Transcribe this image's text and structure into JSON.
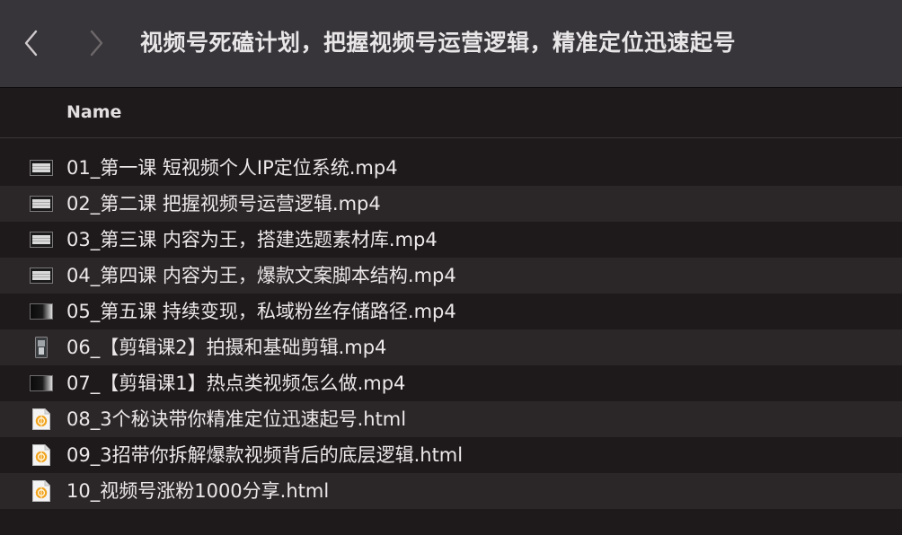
{
  "window": {
    "title": "视频号死磕计划，把握视频号运营逻辑，精准定位迅速起号"
  },
  "toolbar": {
    "back_icon": "chevron-left-icon",
    "forward_icon": "chevron-right-icon"
  },
  "list": {
    "column_name": "Name",
    "files": [
      {
        "name": "01_第一课 短视频个人IP定位系统.mp4",
        "icon": "video-file-icon",
        "thumb": "keyboard"
      },
      {
        "name": "02_第二课 把握视频号运营逻辑.mp4",
        "icon": "video-file-icon",
        "thumb": "keyboard"
      },
      {
        "name": "03_第三课 内容为王，搭建选题素材库.mp4",
        "icon": "video-file-icon",
        "thumb": "keyboard"
      },
      {
        "name": "04_第四课 内容为王，爆款文案脚本结构.mp4",
        "icon": "video-file-icon",
        "thumb": "keyboard"
      },
      {
        "name": "05_第五课 持续变现，私域粉丝存储路径.mp4",
        "icon": "video-file-icon",
        "thumb": "dark"
      },
      {
        "name": "06_【剪辑课2】拍摄和基础剪辑.mp4",
        "icon": "video-file-icon",
        "thumb": "portrait"
      },
      {
        "name": "07_【剪辑课1】热点类视频怎么做.mp4",
        "icon": "video-file-icon",
        "thumb": "dark"
      },
      {
        "name": "08_3个秘诀带你精准定位迅速起号.html",
        "icon": "html-file-icon",
        "thumb": "html"
      },
      {
        "name": "09_3招带你拆解爆款视频背后的底层逻辑.html",
        "icon": "html-file-icon",
        "thumb": "html"
      },
      {
        "name": "10_视频号涨粉1000分享.html",
        "icon": "html-file-icon",
        "thumb": "html"
      }
    ]
  },
  "colors": {
    "titlebar": "#38353a",
    "background": "#1e1a1c",
    "row_alt": "#2b2729",
    "text": "#ece8ea",
    "html_icon_accent": "#f0a21b"
  }
}
